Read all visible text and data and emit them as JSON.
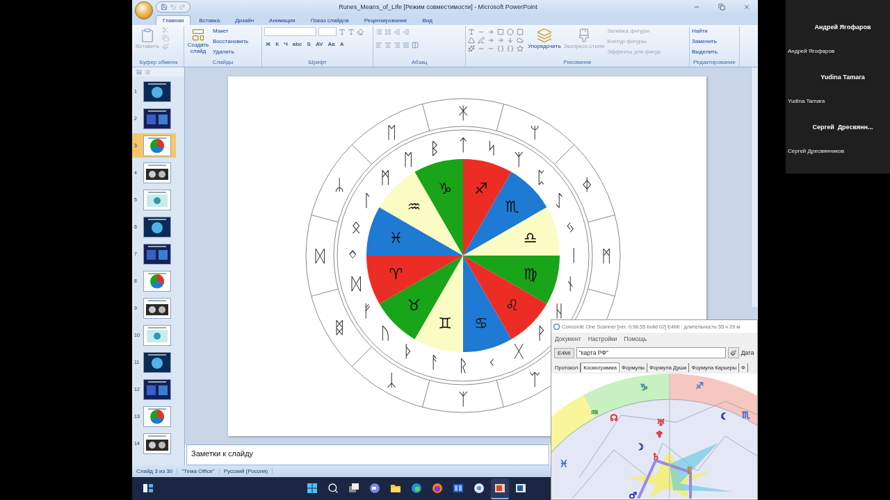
{
  "window": {
    "title": "Runes_Means_of_LIfe [Режим совместимости] - Microsoft PowerPoint"
  },
  "ribbon_tabs": [
    {
      "label": "Главная",
      "selected": true
    },
    {
      "label": "Вставка",
      "selected": false
    },
    {
      "label": "Дизайн",
      "selected": false
    },
    {
      "label": "Анимация",
      "selected": false
    },
    {
      "label": "Показ слайдов",
      "selected": false
    },
    {
      "label": "Рецензирование",
      "selected": false
    },
    {
      "label": "Вид",
      "selected": false
    }
  ],
  "clipboard_group": {
    "label": "Буфер обмена",
    "paste": {
      "label": "Вставить",
      "disabled": true
    }
  },
  "slides_group": {
    "label": "Слайды",
    "new_slide": "Создать слайд",
    "commands": [
      "Макет",
      "Восстановить",
      "Удалить"
    ]
  },
  "font_group": {
    "label": "Шрифт",
    "format_buttons": [
      "Ж",
      "К",
      "Ч",
      "abc",
      "S",
      "AV",
      "Aa",
      "A"
    ]
  },
  "paragraph_group": {
    "label": "Абзац"
  },
  "drawing_group": {
    "label": "Рисование",
    "arrange": "Упорядочить",
    "quick_styles": {
      "label": "Экспресс-стили",
      "disabled": true
    },
    "shape_commands": [
      {
        "label": "Заливка фигуры",
        "disabled": true
      },
      {
        "label": "Контур фигуры",
        "disabled": true
      },
      {
        "label": "Эффекты для фигур",
        "disabled": true
      }
    ]
  },
  "editing_group": {
    "label": "Редактирование",
    "commands": [
      "Найти",
      "Заменить",
      "Выделить"
    ]
  },
  "thumbnails": [
    {
      "number": "1",
      "selected": false
    },
    {
      "number": "2",
      "selected": false
    },
    {
      "number": "3",
      "selected": true
    },
    {
      "number": "4",
      "selected": false
    },
    {
      "number": "5",
      "selected": false
    },
    {
      "number": "6",
      "selected": false
    },
    {
      "number": "7",
      "selected": false
    },
    {
      "number": "8",
      "selected": false
    },
    {
      "number": "9",
      "selected": false
    },
    {
      "number": "10",
      "selected": false
    },
    {
      "number": "11",
      "selected": false
    },
    {
      "number": "12",
      "selected": false
    },
    {
      "number": "13",
      "selected": false
    },
    {
      "number": "14",
      "selected": false
    }
  ],
  "slide": {
    "zodiac": [
      {
        "sign": "♐",
        "color": "#ec2d26"
      },
      {
        "sign": "♏",
        "color": "#1f7ad3"
      },
      {
        "sign": "♎",
        "color": "#fbfbc4"
      },
      {
        "sign": "♍",
        "color": "#19a419"
      },
      {
        "sign": "♌",
        "color": "#ec2d26"
      },
      {
        "sign": "♋",
        "color": "#1f7ad3"
      },
      {
        "sign": "♊",
        "color": "#fbfbc4"
      },
      {
        "sign": "♉",
        "color": "#19a419"
      },
      {
        "sign": "♈",
        "color": "#ec2d26"
      },
      {
        "sign": "♓",
        "color": "#1f7ad3"
      },
      {
        "sign": "♒",
        "color": "#fbfbc4"
      },
      {
        "sign": "♑",
        "color": "#19a419"
      }
    ],
    "inner_runes_top": [
      "ᛜ",
      "ᛟ",
      "ᛚ",
      "ᛗ",
      "ᛖ",
      "ᛒ",
      "ᛏ",
      "ᛋ",
      "ᛉ",
      "ᛈ",
      "ᛇ",
      "ᛃ",
      "ᛁ"
    ],
    "inner_runes_bottom": [
      "ᛞ",
      "ᚠ",
      "ᚢ",
      "ᚦ",
      "ᚨ",
      "ᚱ",
      "ᚲ",
      "ᚷ",
      "ᚹ",
      "ᚺ",
      "ᚾ"
    ],
    "outer_runes_top": [
      "ᛞ",
      "ᛦ",
      "ᛖ",
      "ᛡ",
      "ᛘ",
      "ᛄ",
      "ᛗ"
    ],
    "outer_runes_bottom": [
      "ᛥ",
      "ᛣ",
      "ᛉ",
      "ᛠ"
    ]
  },
  "notes": {
    "placeholder": "Заметки к слайду"
  },
  "status_bar": [
    "Слайд 3 из 30",
    "\"Тема Office\"",
    "Русский (Россия)"
  ],
  "taskbar": [
    {
      "kind": "widgets",
      "active": false
    },
    {
      "kind": "start",
      "active": false
    },
    {
      "kind": "search",
      "active": false
    },
    {
      "kind": "taskview",
      "active": false
    },
    {
      "kind": "chat",
      "active": false
    },
    {
      "kind": "explorer",
      "active": false
    },
    {
      "kind": "edge",
      "active": false
    },
    {
      "kind": "firefox",
      "active": false
    },
    {
      "kind": "app",
      "active": false
    },
    {
      "kind": "scanner",
      "active": false
    },
    {
      "kind": "powerpoint",
      "active": true
    },
    {
      "kind": "word",
      "active": false
    }
  ],
  "participants": [
    {
      "tile_name": "Андрей Ягофаров",
      "name": "Андрей Ягофаров"
    },
    {
      "tile_name": "Yudina Tamara",
      "name": "Yudina Tamara"
    },
    {
      "tile_name": "Сергей  Дресвянн...",
      "name": "Сергей Дресвянников"
    }
  ],
  "scanner": {
    "title": "Concorde One Scanner [ver. 0.98.55 build 02] E4MI : длительность 55 ч 29 м",
    "menu": [
      "Документ",
      "Настройки",
      "Помощь"
    ],
    "code_button": "E4MI",
    "query": "\"карта РФ\"",
    "date_label": "Дата",
    "tabs": [
      {
        "label": "Протокол",
        "selected": false
      },
      {
        "label": "Космограмма",
        "selected": true
      },
      {
        "label": "Формулы",
        "selected": false
      },
      {
        "label": "Формула Души",
        "selected": false
      },
      {
        "label": "Формула Карьеры",
        "selected": false
      },
      {
        "label": "Ф",
        "selected": false
      }
    ],
    "cosmogram": {
      "signs": [
        {
          "symbol": "♑",
          "color": "#2f8f9a"
        },
        {
          "symbol": "♐",
          "color": "#5a7fc8"
        },
        {
          "symbol": "♏",
          "color": "#4a6fc8"
        },
        {
          "symbol": "♒",
          "color": "#4a9a4a"
        },
        {
          "symbol": "♓",
          "color": "#4a6fc8"
        }
      ],
      "planets": [
        {
          "symbol": "☊",
          "color": "#d43c3c"
        },
        {
          "symbol": "♅",
          "color": "#d43c3c"
        },
        {
          "symbol": "♆",
          "color": "#d43c3c"
        },
        {
          "symbol": "☽",
          "color": "#2a3aa8"
        },
        {
          "symbol": "♄",
          "color": "#d43c3c"
        },
        {
          "symbol": "♇",
          "color": "#e0701c"
        },
        {
          "symbol": "♂",
          "color": "#2a3aa8"
        },
        {
          "symbol": "☾",
          "color": "#1a2a90"
        }
      ]
    }
  }
}
